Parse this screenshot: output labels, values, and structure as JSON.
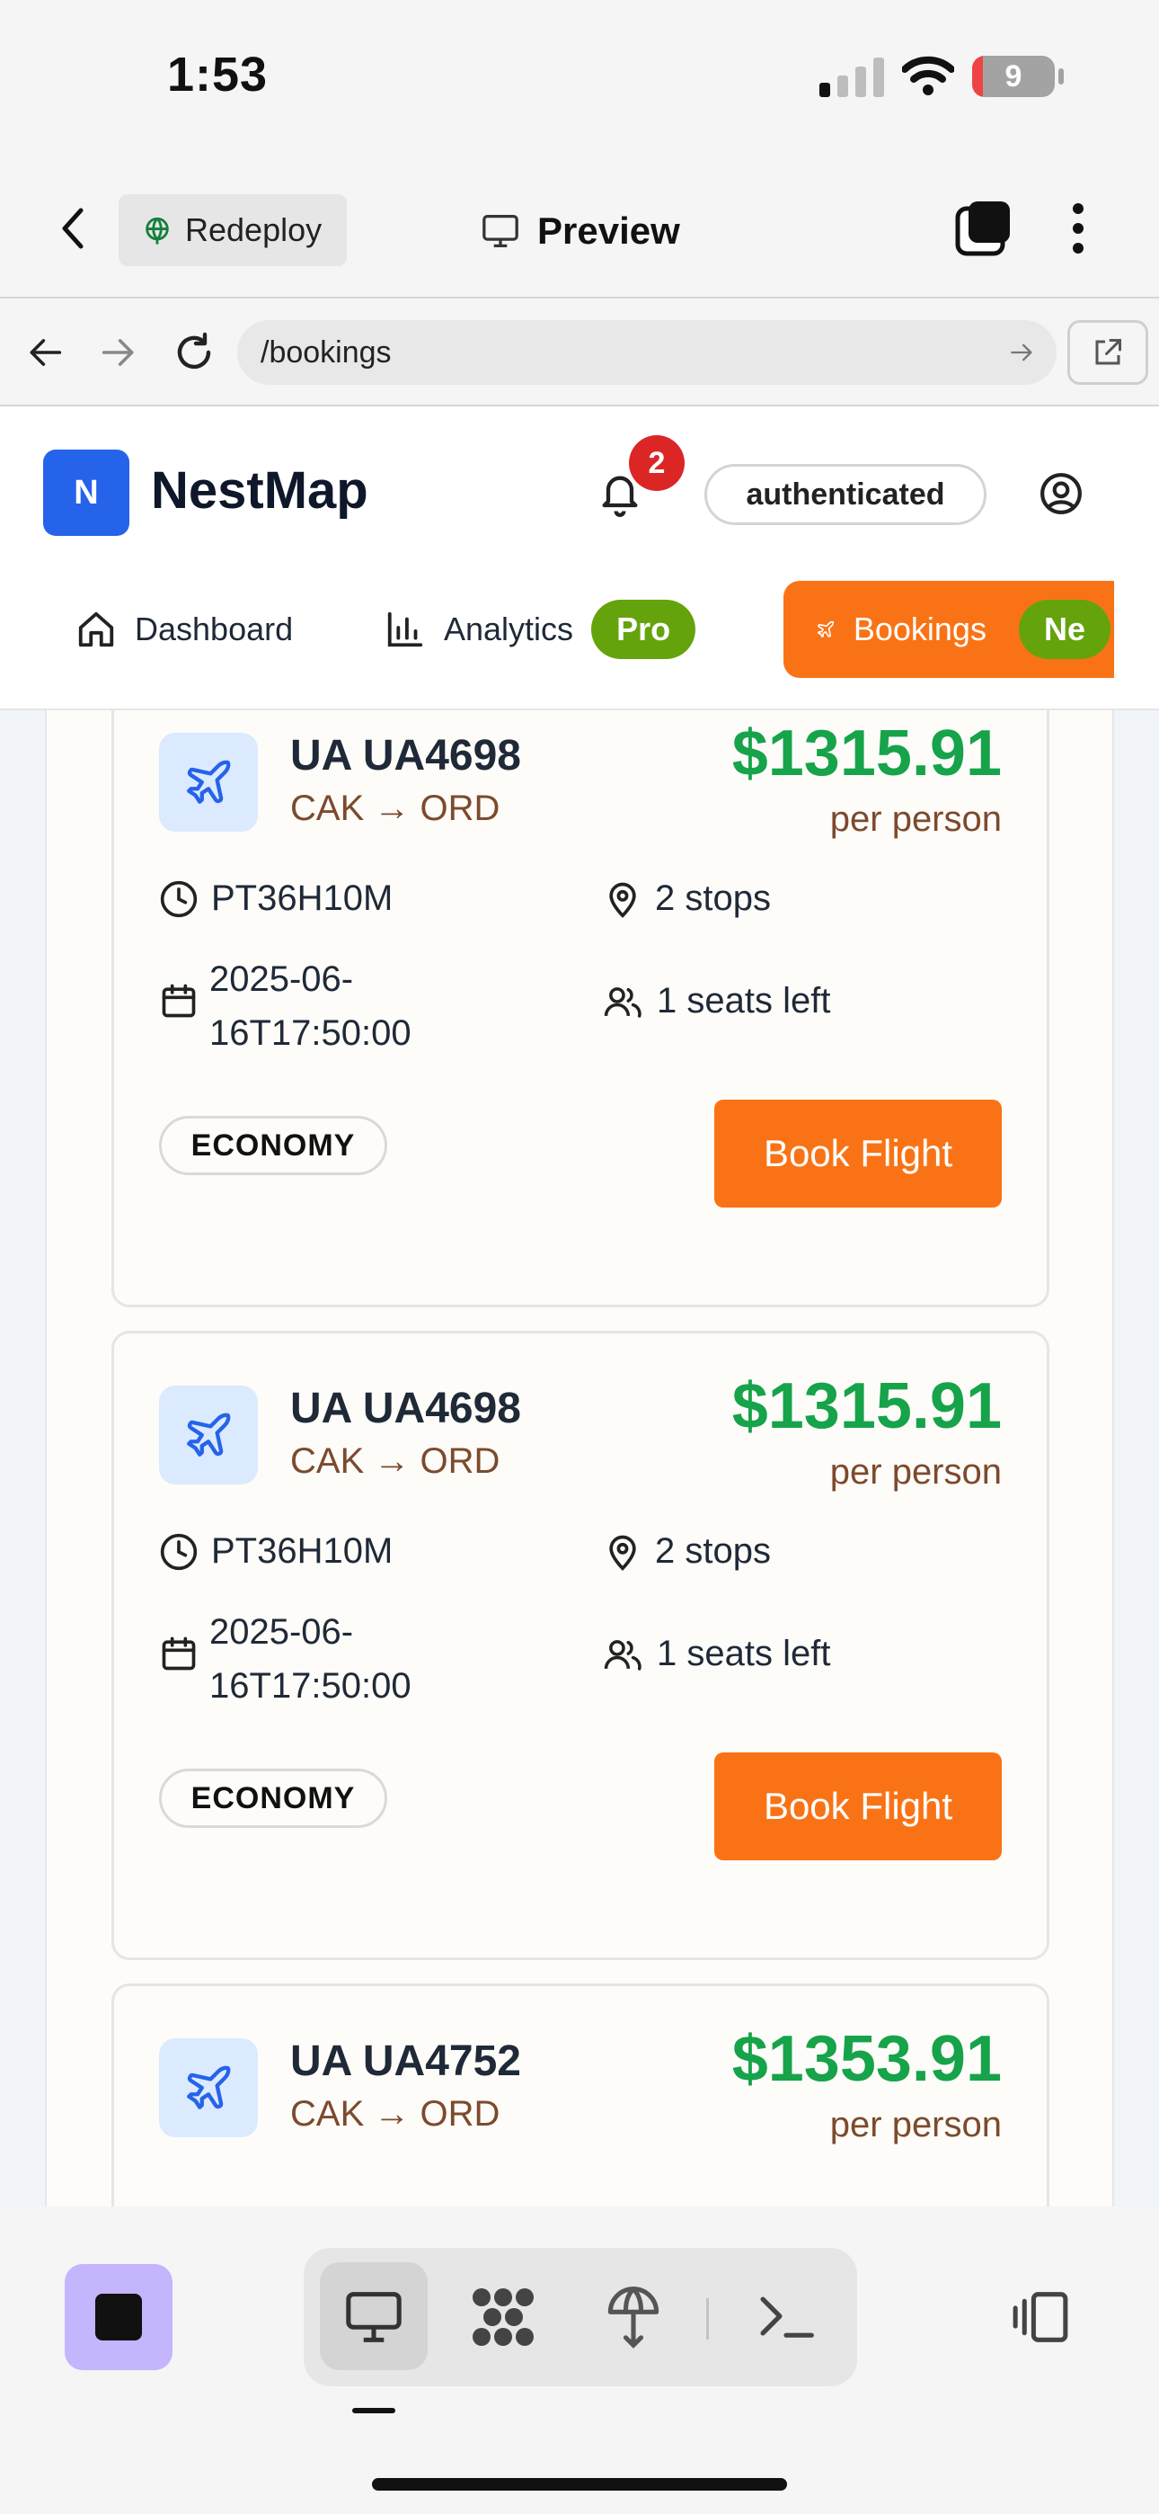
{
  "status_bar": {
    "time": "1:53",
    "battery": "9"
  },
  "app_bar": {
    "redeploy_label": "Redeploy",
    "preview_label": "Preview"
  },
  "browser": {
    "url": "/bookings"
  },
  "site": {
    "logo_letter": "N",
    "brand": "NestMap",
    "notification_count": "2",
    "auth_status": "authenticated",
    "nav": {
      "dashboard": "Dashboard",
      "analytics": "Analytics",
      "analytics_badge": "Pro",
      "bookings": "Bookings",
      "bookings_badge": "Ne"
    }
  },
  "flights": [
    {
      "flight_no": "UA UA4698",
      "route": "CAK → ORD",
      "price": "$1315.91",
      "per": "per person",
      "duration": "PT36H10M",
      "stops": "2 stops",
      "departure_line1": "2025-06-",
      "departure_line2": "16T17:50:00",
      "seats": "1 seats left",
      "cabin": "ECONOMY",
      "book_label": "Book Flight"
    },
    {
      "flight_no": "UA UA4698",
      "route": "CAK → ORD",
      "price": "$1315.91",
      "per": "per person",
      "duration": "PT36H10M",
      "stops": "2 stops",
      "departure_line1": "2025-06-",
      "departure_line2": "16T17:50:00",
      "seats": "1 seats left",
      "cabin": "ECONOMY",
      "book_label": "Book Flight"
    },
    {
      "flight_no": "UA UA4752",
      "route": "CAK → ORD",
      "price": "$1353.91",
      "per": "per person"
    }
  ],
  "colors": {
    "accent": "#f97316",
    "price": "#16a34a",
    "brand": "#2563eb",
    "badge": "#65a30d"
  },
  "icons": [
    "back-icon",
    "globe-icon",
    "monitor-icon",
    "tabs-icon",
    "more-icon",
    "arrow-left-icon",
    "arrow-right-icon",
    "reload-icon",
    "external-link-icon",
    "bell-icon",
    "user-icon",
    "home-icon",
    "bar-chart-icon",
    "plane-icon",
    "clock-icon",
    "map-pin-icon",
    "calendar-icon",
    "users-icon",
    "terminal-icon"
  ]
}
